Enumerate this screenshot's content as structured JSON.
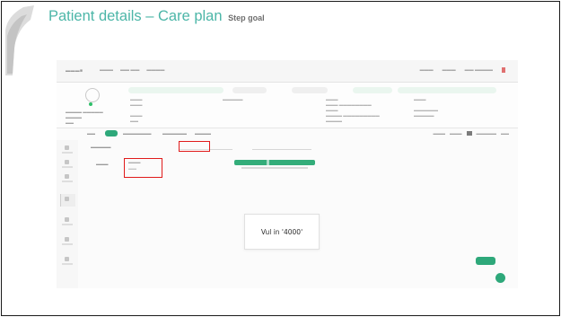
{
  "slide": {
    "title": "Patient details – Care plan",
    "subtitle": "Step goal"
  },
  "instruction": {
    "text": "Vul in '4000'"
  },
  "colors": {
    "title": "#4cb6a8",
    "accent_green": "#2ea87a",
    "highlight_red": "#e01b1b",
    "border": "#1a1a1a"
  }
}
